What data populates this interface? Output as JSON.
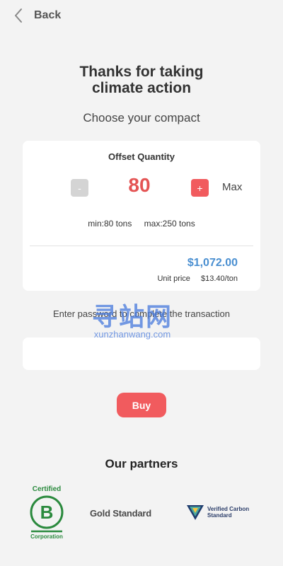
{
  "header": {
    "back_label": "Back"
  },
  "main": {
    "title_line1": "Thanks for taking",
    "title_line2": "climate action",
    "subtitle": "Choose your compact"
  },
  "offset_card": {
    "label": "Offset Quantity",
    "minus_label": "-",
    "plus_label": "+",
    "quantity": "80",
    "max_label": "Max",
    "min_text": "min:80 tons",
    "max_text": "max:250 tons",
    "total": "$1,072.00",
    "unit_price_label": "Unit price",
    "unit_price_value": "$13.40/ton"
  },
  "password": {
    "label": "Enter password to complete the transaction",
    "value": "",
    "placeholder": ""
  },
  "buy_label": "Buy",
  "partners": {
    "title": "Our partners",
    "bcorp_top": "Certified",
    "bcorp_bottom": "Corporation",
    "bcorp_letter": "B",
    "gold_standard": "Gold Standard",
    "vcs_line1": "Verified Carbon",
    "vcs_line2": "Standard"
  },
  "watermark": {
    "text": "寻站网",
    "url": "xunzhanwang.com"
  },
  "colors": {
    "accent": "#f15b5e",
    "price_blue": "#4a8fd1",
    "background": "#f3f3f3",
    "bcorp_green": "#2b8a3e"
  },
  "icons": {
    "back": "chevron-left-icon"
  }
}
